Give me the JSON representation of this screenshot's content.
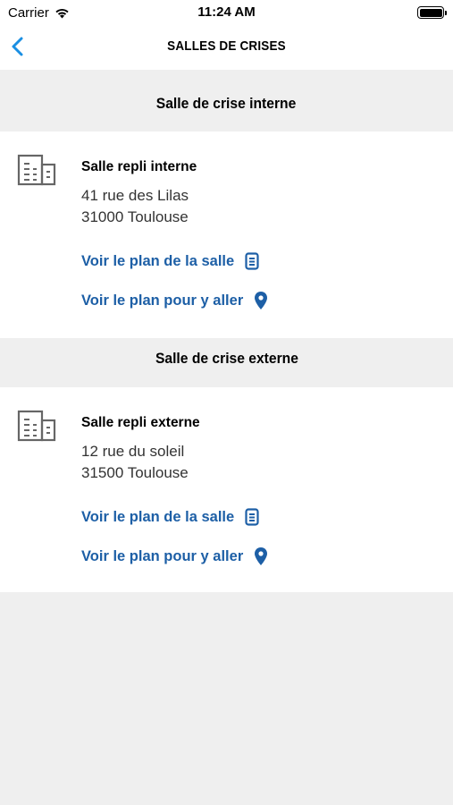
{
  "status_bar": {
    "carrier": "Carrier",
    "time": "11:24 AM"
  },
  "nav": {
    "title": "SALLES DE CRISES"
  },
  "sections": [
    {
      "header": "Salle de crise interne",
      "room_name": "Salle repli interne",
      "address_line1": "41 rue des Lilas",
      "address_line2": "31000 Toulouse",
      "link_plan_salle": "Voir le plan de la salle",
      "link_plan_route": "Voir le plan pour y aller"
    },
    {
      "header": "Salle de crise externe",
      "room_name": "Salle repli externe",
      "address_line1": "12 rue du soleil",
      "address_line2": "31500 Toulouse",
      "link_plan_salle": "Voir le plan de la salle",
      "link_plan_route": "Voir le plan pour y aller"
    }
  ],
  "colors": {
    "accent": "#1d5fa6",
    "back_arrow": "#1a8fe3",
    "background": "#efefef"
  },
  "icons": [
    "wifi-icon",
    "battery-icon",
    "back-chevron-icon",
    "building-icon",
    "document-icon",
    "map-pin-icon"
  ]
}
